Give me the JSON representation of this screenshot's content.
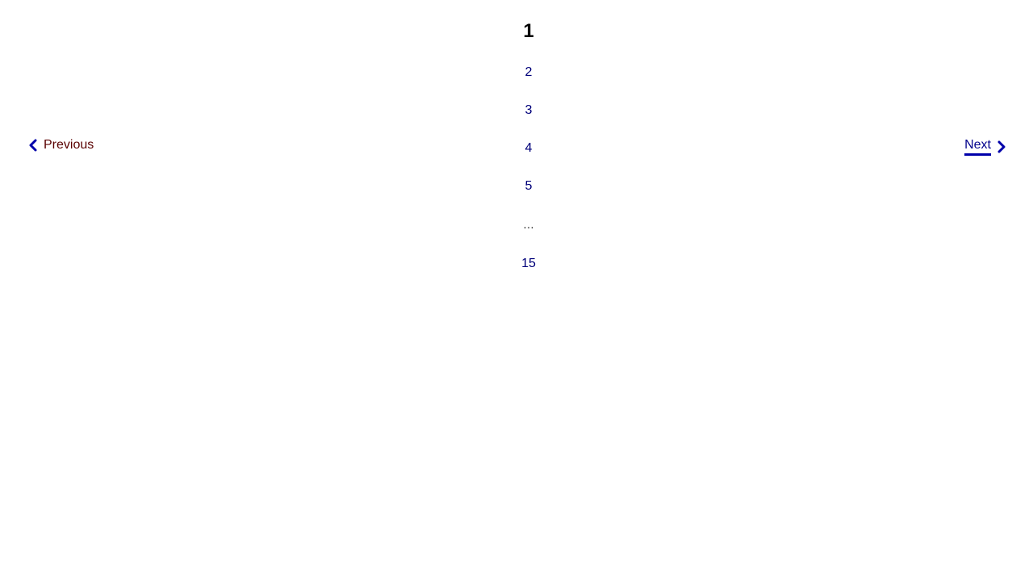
{
  "pagination": {
    "previous_label": "Previous",
    "next_label": "Next",
    "current_page": "1",
    "pages": [
      "2",
      "3",
      "4",
      "5"
    ],
    "ellipsis": "…",
    "last_page": "15"
  },
  "colors": {
    "previous_text": "#5a0000",
    "link_text": "#00007a",
    "next_underline": "#0000aa",
    "chevron": "#0000aa"
  }
}
